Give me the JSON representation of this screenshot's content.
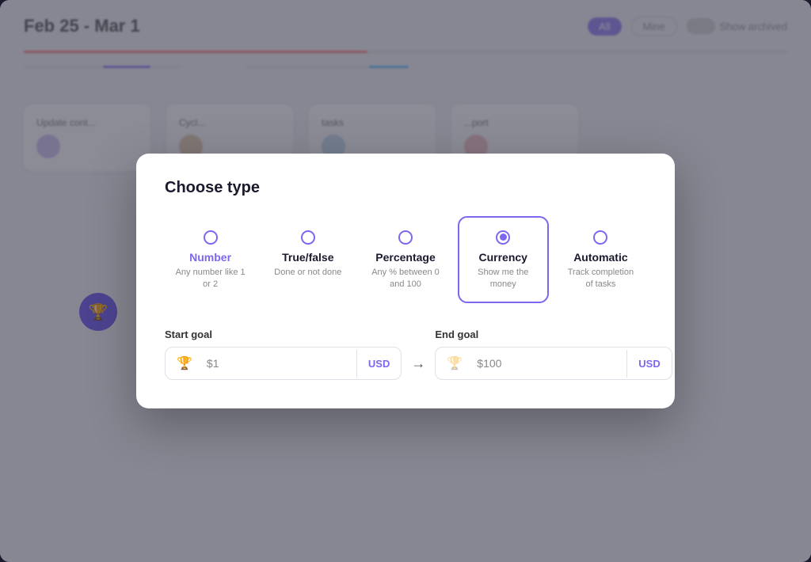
{
  "app": {
    "date_range": "Feb 25 - Mar 1",
    "filter_all": "All",
    "filter_mine": "Mine",
    "show_archived": "Show archived"
  },
  "modal": {
    "title": "Choose type",
    "type_options": [
      {
        "id": "number",
        "name": "Number",
        "description": "Any number like 1 or 2",
        "selected": false,
        "radio": "empty"
      },
      {
        "id": "true_false",
        "name": "True/false",
        "description": "Done or not done",
        "selected": false,
        "radio": "empty"
      },
      {
        "id": "percentage",
        "name": "Percentage",
        "description": "Any % between 0 and 100",
        "selected": false,
        "radio": "empty"
      },
      {
        "id": "currency",
        "name": "Currency",
        "description": "Show me the money",
        "selected": true,
        "radio": "filled"
      },
      {
        "id": "automatic",
        "name": "Automatic",
        "description": "Track completion of tasks",
        "selected": false,
        "radio": "empty"
      }
    ],
    "start_goal": {
      "label": "Start goal",
      "value": "$1",
      "currency": "USD"
    },
    "end_goal": {
      "label": "End goal",
      "value": "$100",
      "currency": "USD"
    },
    "arrow": "→"
  },
  "background": {
    "cards": [
      {
        "title": "Update cont...",
        "avatar": true
      },
      {
        "title": "Cycl...",
        "avatar": true
      },
      {
        "title": "tasks",
        "avatar": true
      },
      {
        "title": "...port",
        "avatar": true
      }
    ]
  }
}
